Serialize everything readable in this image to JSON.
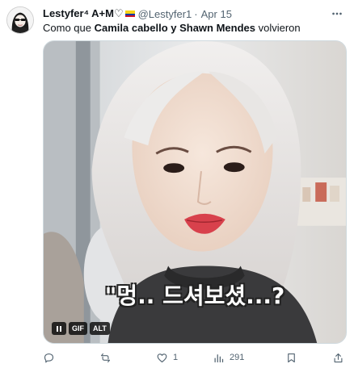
{
  "tweet": {
    "author": {
      "display_name": "Lestyfer⁴ A+M♡",
      "flag_icon": "colombia-flag-icon",
      "handle": "@Lestyfer1",
      "separator": "·",
      "date": "Apr 15"
    },
    "text": {
      "prefix": "Como que ",
      "bold": "Camila cabello y Shawn Mendes",
      "suffix": " volvieron"
    },
    "media": {
      "caption": "\"멍.. 드셔보셨...?",
      "badges": {
        "gif": "GIF",
        "alt": "ALT"
      }
    },
    "actions": {
      "reply_count": "",
      "retweet_count": "",
      "like_count": "1",
      "views_count": "291"
    }
  }
}
